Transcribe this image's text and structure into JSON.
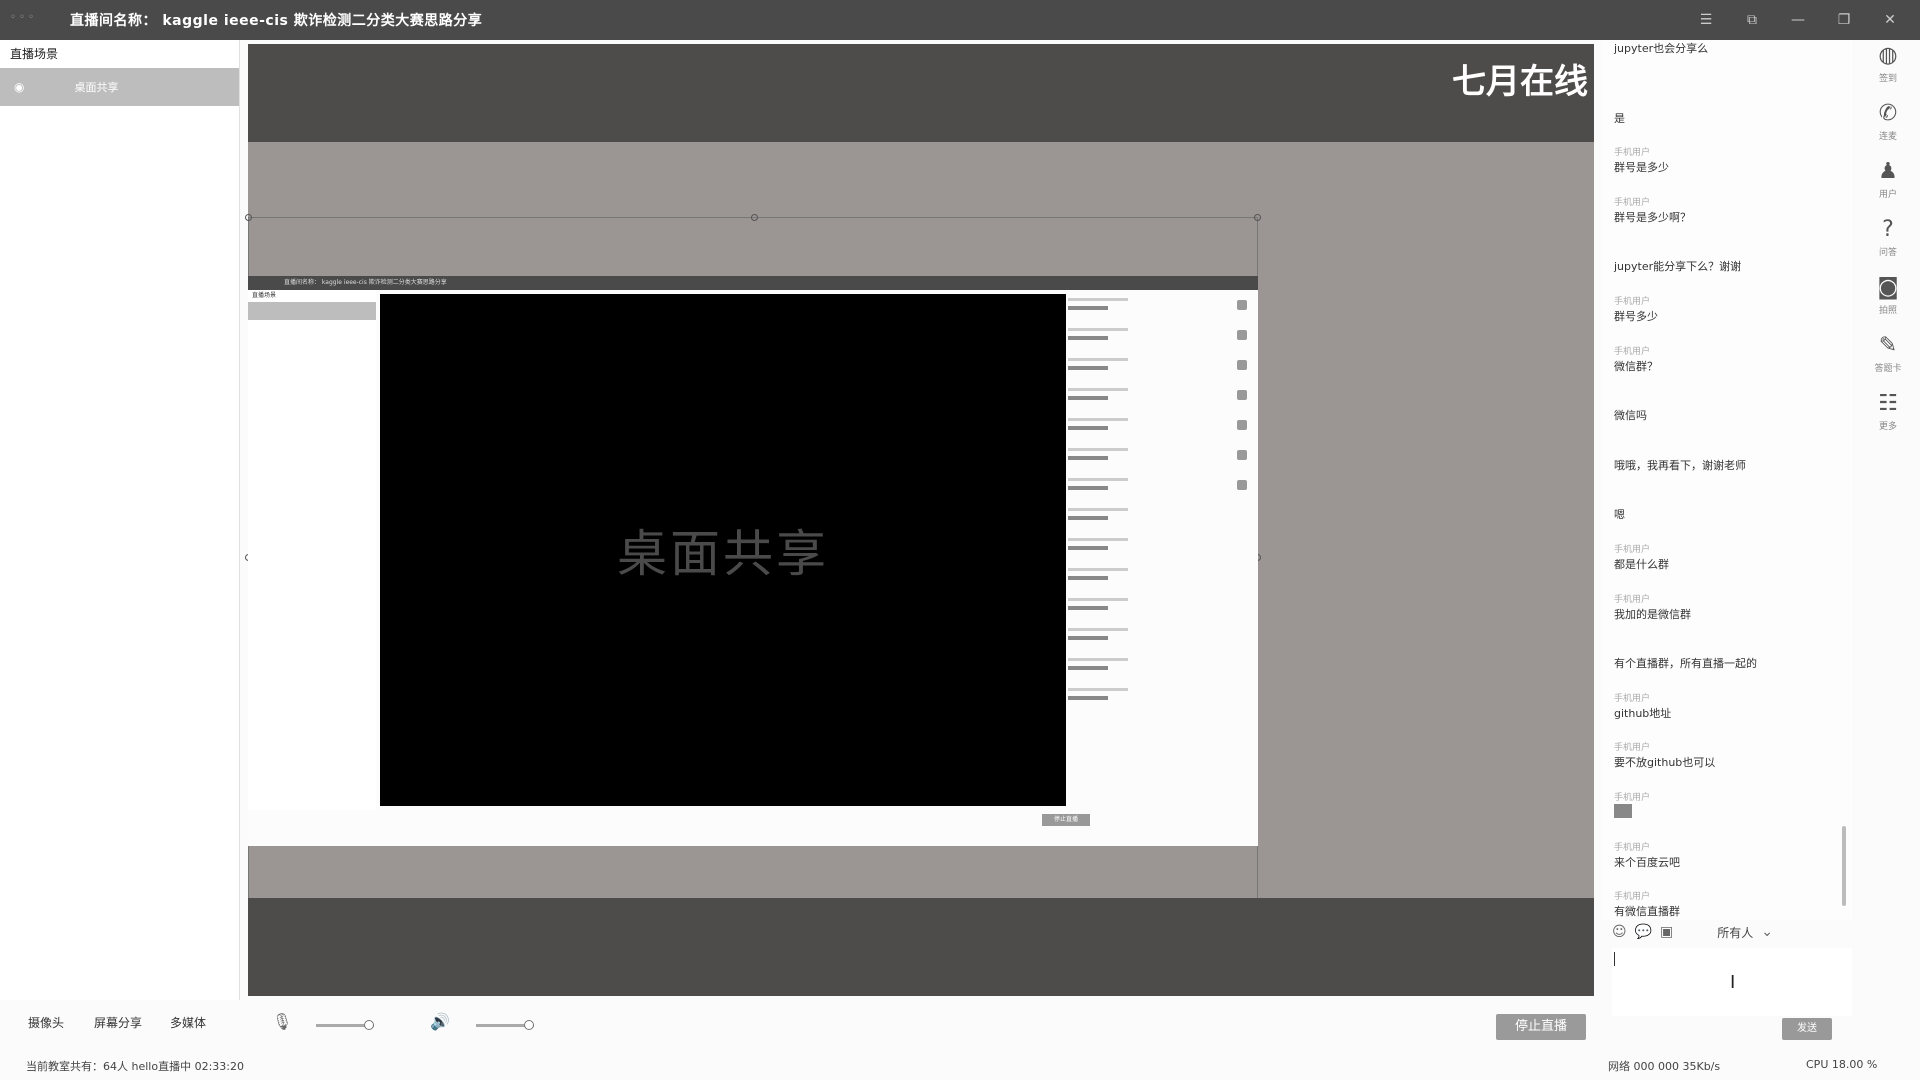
{
  "window": {
    "title": "直播间名称： kaggle ieee-cis 欺诈检测二分类大赛思路分享"
  },
  "scenes": {
    "header": "直播场景",
    "items": [
      {
        "label": "桌面共享"
      }
    ]
  },
  "preview": {
    "watermark": "七月在线",
    "inner_title": "直播间名称： kaggle ieee-cis 欺诈检测二分类大赛思路分享",
    "inner_scene_header": "直播场景",
    "inner_screen_label": "桌面共享",
    "inner_stop_label": "停止直播"
  },
  "chat": {
    "messages": [
      {
        "name": "",
        "text": "jupyter也会分享么"
      },
      {
        "name": "",
        "text": "是"
      },
      {
        "name": "手机用户",
        "text": "群号是多少"
      },
      {
        "name": "手机用户",
        "text": "群号是多少啊？"
      },
      {
        "name": "",
        "text": "jupyter能分享下么？谢谢"
      },
      {
        "name": "手机用户",
        "text": "群号多少"
      },
      {
        "name": "手机用户",
        "text": "微信群？"
      },
      {
        "name": "",
        "text": "微信吗"
      },
      {
        "name": "",
        "text": "哦哦，我再看下，谢谢老师"
      },
      {
        "name": "",
        "text": "嗯"
      },
      {
        "name": "手机用户",
        "text": "都是什么群"
      },
      {
        "name": "手机用户",
        "text": "我加的是微信群"
      },
      {
        "name": "",
        "text": "有个直播群，所有直播一起的"
      },
      {
        "name": "手机用户",
        "text": "github地址"
      },
      {
        "name": "手机用户",
        "text": "要不放github也可以"
      },
      {
        "name": "手机用户",
        "text": ""
      },
      {
        "name": "手机用户",
        "text": "来个百度云吧"
      },
      {
        "name": "手机用户",
        "text": "有微信直播群"
      }
    ],
    "audience": "所有人",
    "send_label": "发送"
  },
  "right_tools": [
    {
      "icon": "record-icon",
      "label": "签到"
    },
    {
      "icon": "phone-icon",
      "label": "连麦"
    },
    {
      "icon": "user-icon",
      "label": "用户"
    },
    {
      "icon": "question-icon",
      "label": "问答"
    },
    {
      "icon": "camera-icon",
      "label": "拍照"
    },
    {
      "icon": "edit-icon",
      "label": "答题卡"
    },
    {
      "icon": "more-icon",
      "label": "更多"
    }
  ],
  "bottom": {
    "camera": "摄像头",
    "screen_share": "屏幕分享",
    "multimedia": "多媒体",
    "stop_live": "停止直播"
  },
  "status": {
    "left": "当前教室共有：64人   hello直播中   02:33:20",
    "net": "网络 000 000  35Kb/s",
    "cpu": "CPU  18.00 %"
  }
}
